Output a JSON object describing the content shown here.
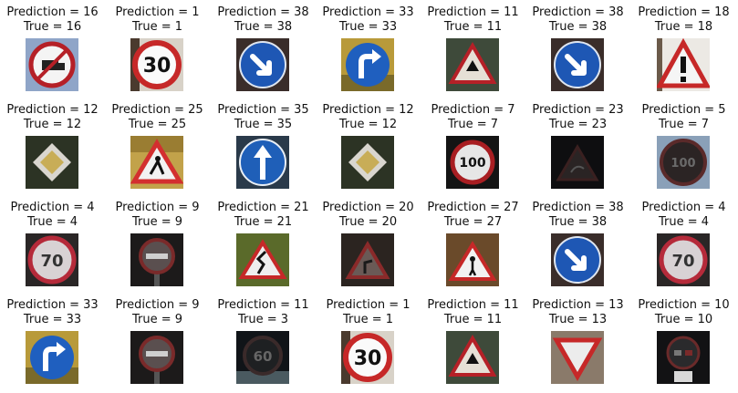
{
  "grid": [
    [
      {
        "pred": "Prediction = 16",
        "true": "True = 16",
        "icon": "no-trucks-sign-icon"
      },
      {
        "pred": "Prediction = 1",
        "true": "True = 1",
        "icon": "speed-limit-30-sign-icon"
      },
      {
        "pred": "Prediction = 38",
        "true": "True = 38",
        "icon": "keep-right-sign-icon"
      },
      {
        "pred": "Prediction = 33",
        "true": "True = 33",
        "icon": "turn-right-ahead-sign-icon"
      },
      {
        "pred": "Prediction = 11",
        "true": "True = 11",
        "icon": "right-of-way-sign-icon"
      },
      {
        "pred": "Prediction = 38",
        "true": "True = 38",
        "icon": "keep-right-sign-icon"
      },
      {
        "pred": "Prediction = 18",
        "true": "True = 18",
        "icon": "general-caution-sign-icon"
      }
    ],
    [
      {
        "pred": "Prediction = 12",
        "true": "True = 12",
        "icon": "priority-road-sign-icon"
      },
      {
        "pred": "Prediction = 25",
        "true": "True = 25",
        "icon": "road-work-sign-icon"
      },
      {
        "pred": "Prediction = 35",
        "true": "True = 35",
        "icon": "ahead-only-sign-icon"
      },
      {
        "pred": "Prediction = 12",
        "true": "True = 12",
        "icon": "priority-road-sign-icon"
      },
      {
        "pred": "Prediction = 7",
        "true": "True = 7",
        "icon": "speed-limit-100-sign-icon"
      },
      {
        "pred": "Prediction = 23",
        "true": "True = 23",
        "icon": "slippery-road-sign-icon"
      },
      {
        "pred": "Prediction = 5",
        "true": "True = 7",
        "icon": "speed-limit-sign-icon"
      }
    ],
    [
      {
        "pred": "Prediction = 4",
        "true": "True = 4",
        "icon": "speed-limit-70-sign-icon"
      },
      {
        "pred": "Prediction = 9",
        "true": "True = 9",
        "icon": "no-passing-sign-icon"
      },
      {
        "pred": "Prediction = 21",
        "true": "True = 21",
        "icon": "double-curve-sign-icon"
      },
      {
        "pred": "Prediction = 20",
        "true": "True = 20",
        "icon": "dangerous-curve-right-sign-icon"
      },
      {
        "pred": "Prediction = 27",
        "true": "True = 27",
        "icon": "pedestrians-sign-icon"
      },
      {
        "pred": "Prediction = 38",
        "true": "True = 38",
        "icon": "keep-right-sign-icon"
      },
      {
        "pred": "Prediction = 4",
        "true": "True = 4",
        "icon": "speed-limit-70-sign-icon"
      }
    ],
    [
      {
        "pred": "Prediction = 33",
        "true": "True = 33",
        "icon": "turn-right-ahead-sign-icon"
      },
      {
        "pred": "Prediction = 9",
        "true": "True = 9",
        "icon": "no-passing-sign-icon"
      },
      {
        "pred": "Prediction = 11",
        "true": "True = 3",
        "icon": "speed-limit-60-sign-icon"
      },
      {
        "pred": "Prediction = 1",
        "true": "True = 1",
        "icon": "speed-limit-30-sign-icon"
      },
      {
        "pred": "Prediction = 11",
        "true": "True = 11",
        "icon": "right-of-way-sign-icon"
      },
      {
        "pred": "Prediction = 13",
        "true": "True = 13",
        "icon": "yield-sign-icon"
      },
      {
        "pred": "Prediction = 10",
        "true": "True = 10",
        "icon": "no-passing-trucks-sign-icon"
      }
    ]
  ]
}
